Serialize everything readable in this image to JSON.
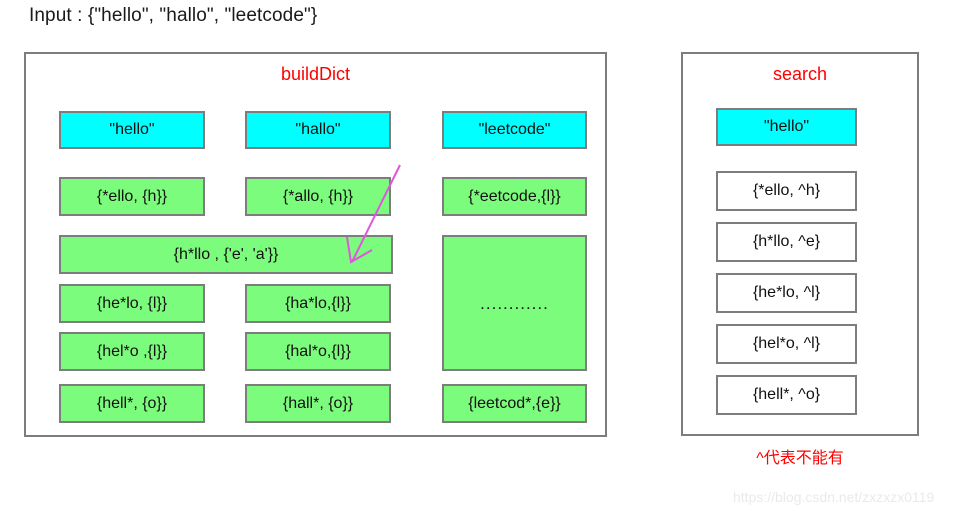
{
  "caption": {
    "text": "Input : {\"hello\", \"hallo\", \"leetcode\"}"
  },
  "colors": {
    "title_red": "#FF0000",
    "word_cyan": "#00FFFF",
    "entry_green": "#7CFC7C",
    "border_gray": "#7D7D7D",
    "arrow_magenta": "#E055E0",
    "watermark_gray": "#E9EAEC"
  },
  "build_panel": {
    "title": "buildDict",
    "columns": [
      {
        "word": "\"hello\"",
        "entries": [
          "{*ello, {h}}",
          "{h*llo , {'e', 'a'}}",
          "{he*lo, {l}}",
          "{hel*o ,{l}}",
          "{hell*, {o}}"
        ]
      },
      {
        "word": "\"hallo\"",
        "entries": [
          "{*allo,  {h}}",
          "{ha*lo,{l}}",
          "{hal*o,{l}}",
          "{hall*, {o}}"
        ]
      },
      {
        "word": "\"leetcode\"",
        "entries": [
          "{*eetcode,{l}}",
          "............",
          "{leetcod*,{e}}"
        ]
      }
    ]
  },
  "search_panel": {
    "title": "search",
    "query": "\"hello\"",
    "entries": [
      "{*ello, ^h}",
      "{h*llo, ^e}",
      "{he*lo, ^l}",
      "{hel*o, ^l}",
      "{hell*, ^o}"
    ]
  },
  "footnote": {
    "text": "^代表不能有"
  },
  "watermark": {
    "text": "https://blog.csdn.net/zxzxzx0119"
  }
}
